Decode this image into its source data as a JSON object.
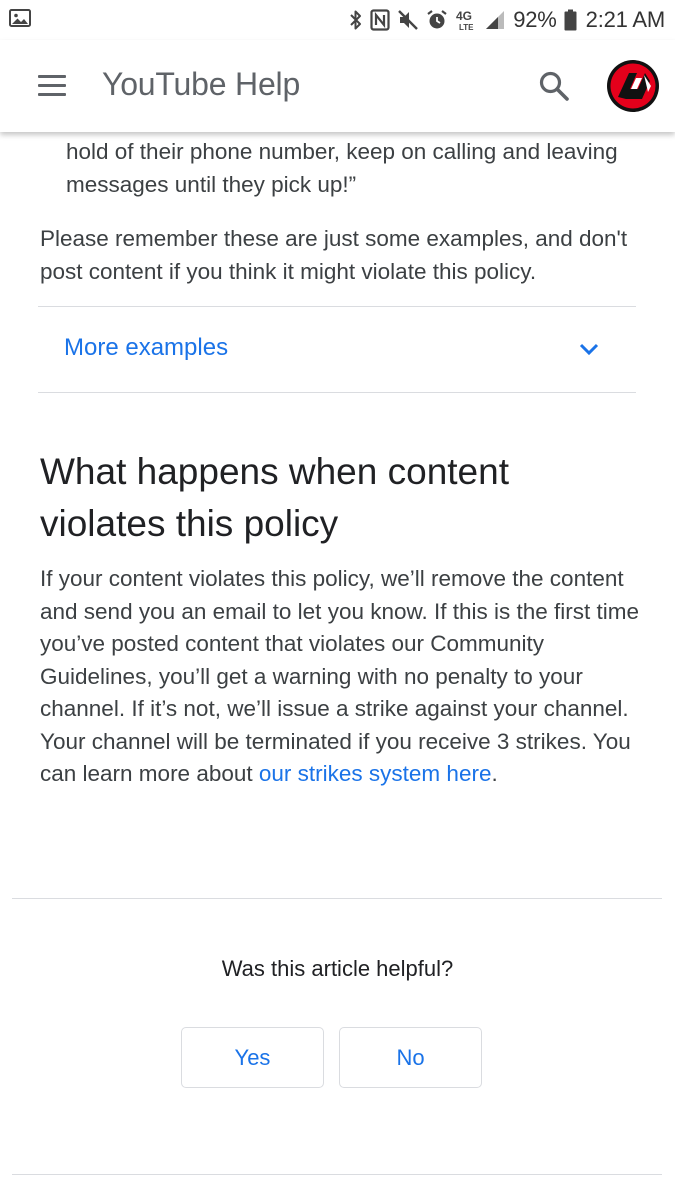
{
  "status_bar": {
    "icons": [
      "gallery-icon",
      "bluetooth-icon",
      "nfc-icon",
      "mute-icon",
      "alarm-icon",
      "network-4g-lte-icon",
      "signal-icon",
      "battery-icon"
    ],
    "network_label": "4G",
    "battery_percent": "92%",
    "time": "2:21 AM"
  },
  "app_bar": {
    "title": "YouTube Help",
    "menu_icon": "menu-icon",
    "search_icon": "search-icon",
    "avatar_colors": {
      "ring": "#e4001b",
      "inner": "#111111",
      "accent": "#ffffff"
    }
  },
  "article": {
    "quote_continuation": "hold of their phone number, keep on calling and leaving messages until they pick up!”",
    "remember_note": "Please remember these are just some examples, and don't post content if you think it might violate this policy.",
    "more_examples": {
      "label": "More examples",
      "icon": "chevron-down-icon"
    },
    "section_heading": "What happens when content violates this policy",
    "section_body": "If your content violates this policy, we’ll remove the content and send you an email to let you know. If this is the first time you’ve posted content that violates our Community Guidelines, you’ll get a warning with no penalty to your channel. If it’s not, we’ll issue a strike against your channel. Your channel will be terminated if you receive 3 strikes. You can learn more about ",
    "strikes_link": "our strikes system here",
    "section_body_end": "."
  },
  "feedback": {
    "question": "Was this article helpful?",
    "yes_label": "Yes",
    "no_label": "No"
  },
  "colors": {
    "link": "#1a73e8",
    "text": "#3c4043",
    "heading": "#202124",
    "divider": "#dadce0"
  }
}
